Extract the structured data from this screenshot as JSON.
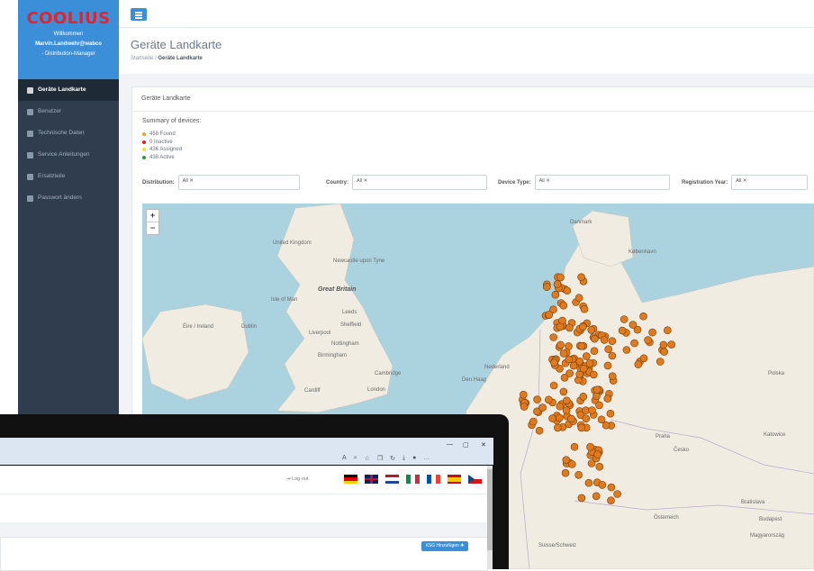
{
  "sidebar": {
    "logo": "COOLIUS",
    "welcome": "Willkommen",
    "user": "Marvin.Landwehr@wabco",
    "role": "- Distribution-Manager",
    "items": [
      {
        "label": "Geräte Landkarte",
        "icon": "map-icon",
        "active": true
      },
      {
        "label": "Benutzer",
        "icon": "users-icon",
        "active": false
      },
      {
        "label": "Technische Daten",
        "icon": "search-icon",
        "active": false
      },
      {
        "label": "Service Anleitungen",
        "icon": "book-icon",
        "active": false
      },
      {
        "label": "Ersatzteile",
        "icon": "wrench-icon",
        "active": false
      },
      {
        "label": "Passwort ändern",
        "icon": "key-icon",
        "active": false
      }
    ]
  },
  "header": {
    "title": "Geräte Landkarte",
    "breadcrumb": {
      "home": "Startseite",
      "sep": "/",
      "current": "Geräte Landkarte"
    }
  },
  "card": {
    "title": "Geräte Landkarte",
    "summary_title": "Summary of devices:",
    "summary": [
      {
        "text": "458 Found",
        "color": "#f0a020"
      },
      {
        "text": "0 Inactive",
        "color": "#e02020"
      },
      {
        "text": "436 Assigned",
        "color": "#f0e030"
      },
      {
        "text": "438 Active",
        "color": "#2a9a3a"
      }
    ]
  },
  "filters": [
    {
      "label": "Distribution:",
      "value": "All ✕"
    },
    {
      "label": "Country:",
      "value": "All ✕"
    },
    {
      "label": "Device Type:",
      "value": "All ✕"
    },
    {
      "label": "Registration Year:",
      "value": "All ✕"
    }
  ],
  "map": {
    "zoom_in": "+",
    "zoom_out": "−",
    "marker_color": "#e07a1f",
    "labels": {
      "united_kingdom": "United Kingdom",
      "great_britain": "Great Britain",
      "isle_of_man": "Isle of Man",
      "eire": "Éire / Ireland",
      "dublin": "Dublin",
      "newcastle": "Newcastle upon Tyne",
      "leeds": "Leeds",
      "sheffield": "Sheffield",
      "liverpool": "Liverpool",
      "nottingham": "Nottingham",
      "birmingham": "Birmingham",
      "cardiff": "Cardiff",
      "london": "London",
      "cambridge": "Cambridge",
      "danmark": "Danmark",
      "kobenhavn": "København",
      "nederland": "Nederland",
      "den_haag": "Den Haag",
      "praha": "Praha",
      "cesko": "Česko",
      "bratislava": "Bratislava",
      "budapest": "Budapest",
      "magyarorszag": "Magyarország",
      "osterreich": "Österreich",
      "polska": "Polska",
      "katowice": "Katowice",
      "suisse": "Suisse/Schweiz"
    }
  },
  "overlay": {
    "window_controls": [
      "—",
      "▢",
      "✕"
    ],
    "logout": "⇥ Log out",
    "add_button": "KSG Hinzufügen ✚",
    "flags": [
      "de",
      "gb",
      "nl",
      "it",
      "fr",
      "es",
      "cz"
    ]
  }
}
